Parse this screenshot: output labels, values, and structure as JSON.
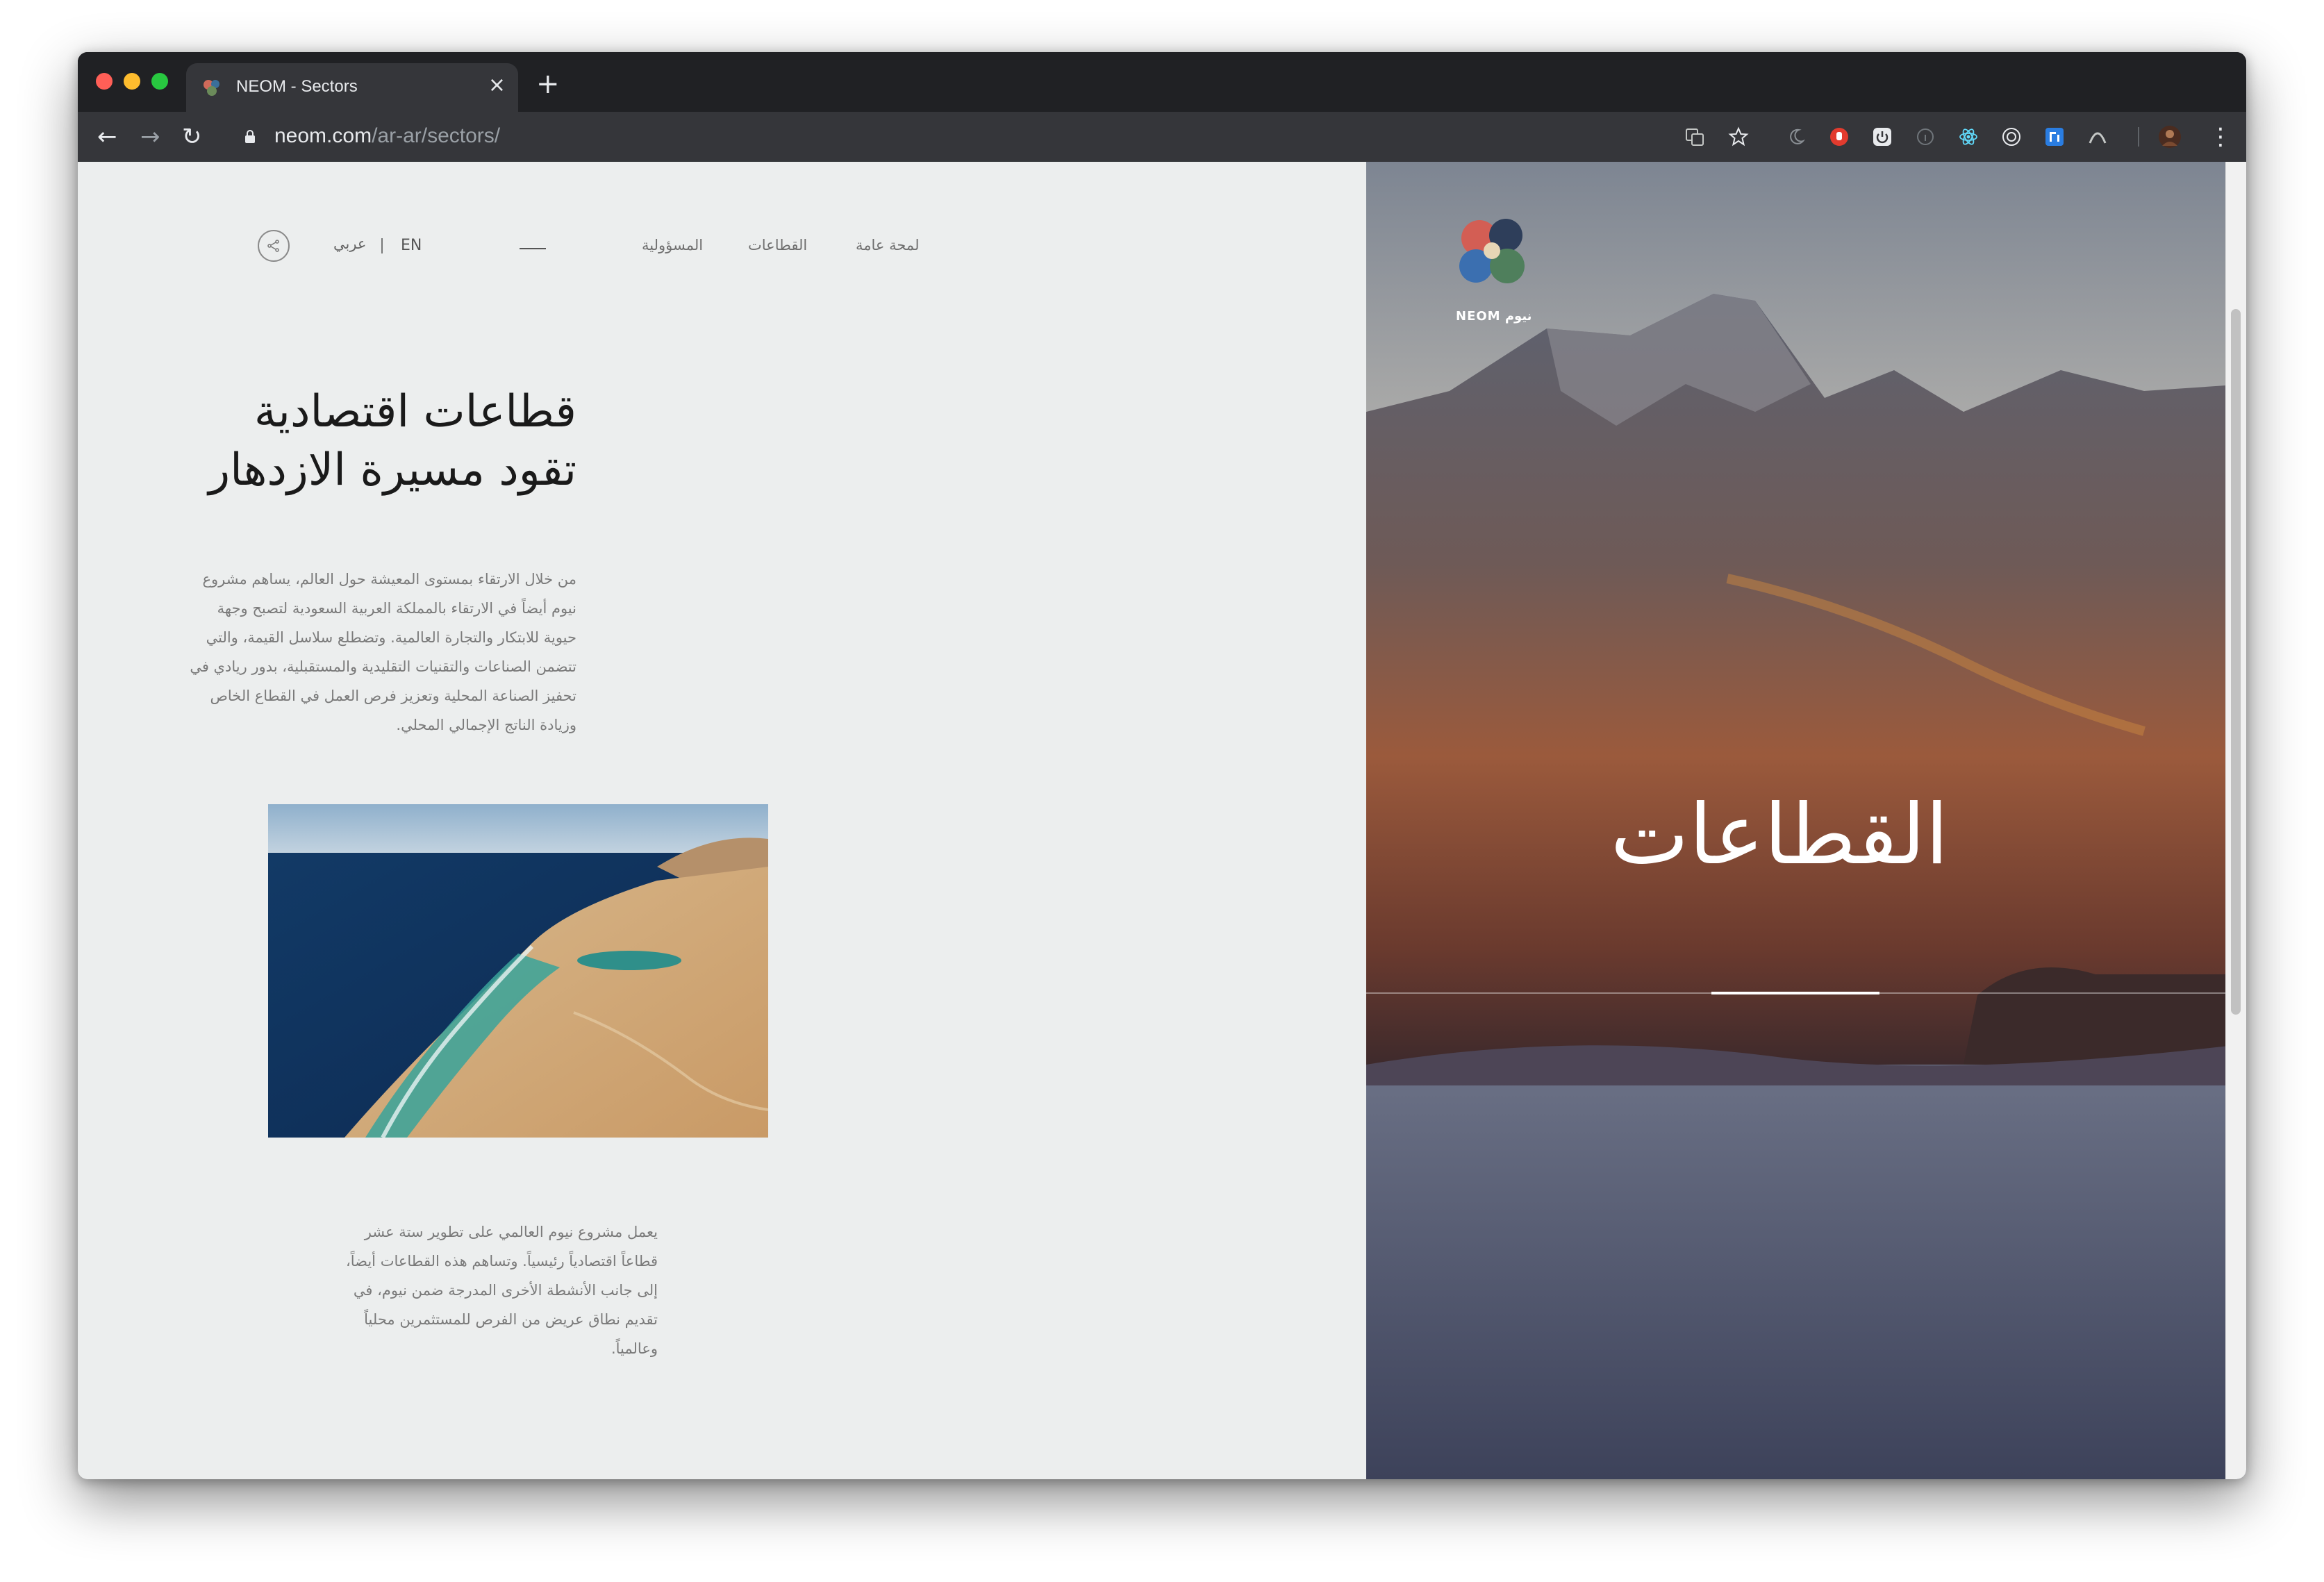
{
  "browser": {
    "tab_title": "NEOM - Sectors",
    "tab_close": "×",
    "new_tab": "+",
    "url_host": "neom.com",
    "url_path": "/ar-ar/sectors/",
    "back": "←",
    "forward": "→",
    "reload": "↻",
    "menu": "⋮"
  },
  "nav": {
    "items": [
      "لمحة عامة",
      "القطاعات",
      "المسؤولية"
    ],
    "lang_en": "EN",
    "lang_ar": "عربي"
  },
  "hero": {
    "title": "القطاعات",
    "logo_text": "نيوم NEOM"
  },
  "content": {
    "headline_line1": "قطاعات اقتصادية",
    "headline_line2": "تقود مسيرة الازدهار",
    "paragraph1": "من خلال الارتقاء بمستوى المعيشة حول العالم، يساهم مشروع نيوم أيضاً في الارتقاء بالمملكة العربية السعودية لتصبح وجهة حيوية للابتكار والتجارة العالمية. وتضطلع سلاسل القيمة، والتي تتضمن الصناعات والتقنيات التقليدية والمستقبلية، بدور ريادي في تحفيز الصناعة المحلية وتعزيز فرص العمل في القطاع الخاص وزيادة الناتج الإجمالي المحلي.",
    "paragraph2": "يعمل مشروع نيوم العالمي على تطوير ستة عشر قطاعاً اقتصادياً رئيسياً. وتساهم هذه القطاعات أيضاً، إلى جانب الأنشطة الأخرى المدرجة ضمن نيوم، في تقديم نطاق عريض من الفرص للمستثمرين محلياً وعالمياً."
  },
  "colors": {
    "page_bg": "#eceeee",
    "chrome_dark": "#202124",
    "chrome_toolbar": "#35363a",
    "text_dark": "#1a1a1a",
    "text_muted": "#7a7a7a"
  }
}
